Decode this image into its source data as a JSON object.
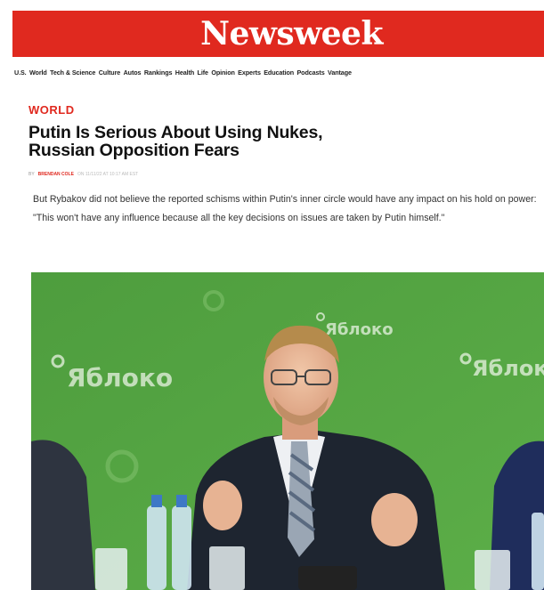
{
  "site": {
    "logo": "Newsweek",
    "brand_color": "#e0291f"
  },
  "nav": {
    "items": [
      "U.S.",
      "World",
      "Tech & Science",
      "Culture",
      "Autos",
      "Rankings",
      "Health",
      "Life",
      "Opinion",
      "Experts",
      "Education",
      "Podcasts",
      "Vantage"
    ]
  },
  "article": {
    "section": "WORLD",
    "headline_line1": "Putin Is Serious About Using Nukes,",
    "headline_line2": "Russian Opposition Fears",
    "byline": {
      "by": "BY",
      "author": "BRENDAN COLE",
      "date": "ON 11/11/22 AT 10:17 AM EST"
    },
    "paragraph": "But Rybakov did not believe the reported schisms within Putin's inner circle would have any impact on his hold on power: \"This won't have any influence because all the key decisions on issues are taken by Putin himself.\""
  },
  "photo": {
    "backdrop_text": "Яблоко",
    "icon": "person-at-press-conference-photo"
  }
}
